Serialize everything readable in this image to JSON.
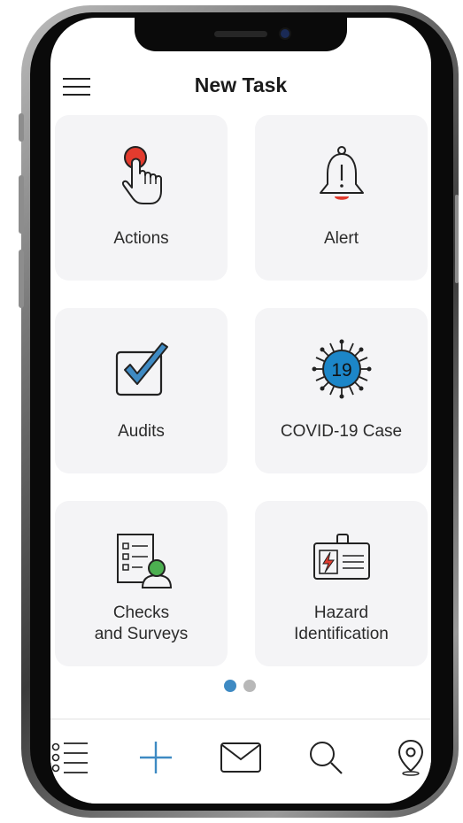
{
  "header": {
    "title": "New Task",
    "menu_icon": "hamburger-menu-icon"
  },
  "tiles": [
    {
      "label": "Actions",
      "icon": "tap-hand-icon"
    },
    {
      "label": "Alert",
      "icon": "bell-icon"
    },
    {
      "label": "Audits",
      "icon": "checkbox-icon"
    },
    {
      "label": "COVID-19 Case",
      "icon": "virus-icon",
      "icon_text": "19"
    },
    {
      "label_line1": "Checks",
      "label_line2": "and Surveys",
      "icon": "checklist-user-icon"
    },
    {
      "label_line1": "Hazard",
      "label_line2": "Identification",
      "icon": "hazard-badge-icon"
    }
  ],
  "pagination": {
    "pages": 2,
    "current": 1
  },
  "bottom_nav": [
    {
      "name": "list",
      "icon": "list-icon"
    },
    {
      "name": "add",
      "icon": "plus-icon"
    },
    {
      "name": "messages",
      "icon": "mail-icon"
    },
    {
      "name": "search",
      "icon": "search-icon"
    },
    {
      "name": "location",
      "icon": "location-pin-icon"
    }
  ],
  "colors": {
    "accent": "#3e8ac3",
    "red": "#e23b2e",
    "tile_bg": "#f4f4f6",
    "green": "#4caf50",
    "virus_blue": "#1c86c8"
  }
}
